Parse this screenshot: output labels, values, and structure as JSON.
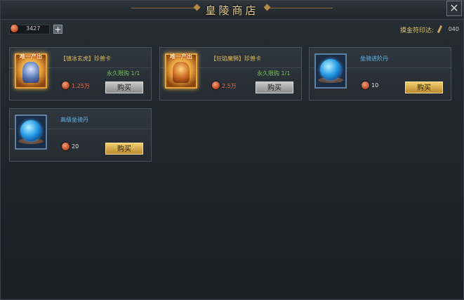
{
  "window": {
    "title": "皇陵商店",
    "close_glyph": "✕"
  },
  "topbar": {
    "currency_amount": "3427",
    "add_glyph": "+",
    "seal_label": "摸金符印达:",
    "seal_count": "040"
  },
  "items": [
    {
      "ribbon": "唯一产出",
      "name": "【镇冰玄虎】珍兽卡",
      "limit": "永久限购 1/1",
      "price": "1.25万",
      "buy_label": "购买"
    },
    {
      "ribbon": "唯一产出",
      "name": "【狂焰魔狮】珍兽卡",
      "limit": "永久限购 1/1",
      "price": "2.5万",
      "buy_label": "购买"
    },
    {
      "name": "坐骑进阶丹",
      "price": "10",
      "buy_label": "购买"
    },
    {
      "name": "高级坐骑丹",
      "price": "20",
      "buy_label": "购买"
    }
  ],
  "colors": {
    "gold": "#e0b95a",
    "blue": "#5fb4e8",
    "green": "#74c25a",
    "red_price": "#e56a4a"
  }
}
